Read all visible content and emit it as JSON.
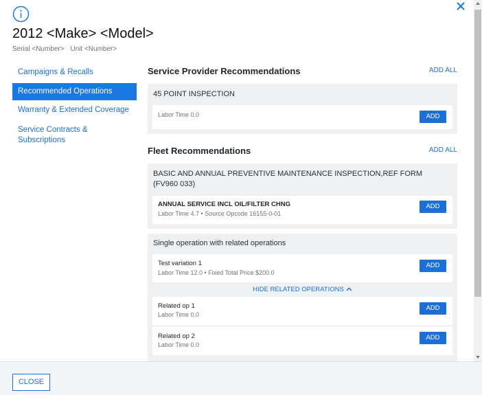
{
  "header": {
    "title": "2012 <Make> <Model>",
    "serial_label": "Serial",
    "serial_value": "<Number>",
    "unit_label": "Unit",
    "unit_value": "<Number>"
  },
  "sidebar": {
    "items": [
      {
        "label": "Campaigns & Recalls"
      },
      {
        "label": "Recommended Operations"
      },
      {
        "label": "Warranty & Extended Coverage"
      },
      {
        "label": "Service Contracts & Subscriptions"
      }
    ],
    "active_index": 1
  },
  "sections": {
    "service_provider": {
      "title": "Service Provider Recommendations",
      "add_all": "ADD ALL",
      "group_title": "45 POINT INSPECTION",
      "ops": [
        {
          "name": "",
          "meta": "Labor Time 0.0",
          "button": "ADD"
        }
      ]
    },
    "fleet": {
      "title": "Fleet Recommendations",
      "add_all": "ADD ALL",
      "group1": {
        "title": "BASIC AND ANNUAL PREVENTIVE MAINTENANCE INSPECTION,REF FORM (FV960 033)",
        "op": {
          "name": "ANNUAL SERVICE INCL OIL/FILTER CHNG",
          "meta": "Labor Time 4.7 • Source Opcode 16155-0-01",
          "button": "ADD"
        }
      },
      "group2": {
        "title": "Single operation with related operations",
        "op": {
          "name": "Test variation 1",
          "meta": "Labor Time 12.0 • Fixed Total Price $200.0",
          "button": "ADD"
        },
        "hide_related": "HIDE RELATED OPERATIONS",
        "related": [
          {
            "name": "Related op 1",
            "meta": "Labor Time 0.0",
            "button": "ADD"
          },
          {
            "name": "Related op 2",
            "meta": "Labor Time 0.0",
            "button": "ADD"
          }
        ]
      }
    }
  },
  "footer": {
    "close_label": "CLOSE"
  },
  "colors": {
    "accent": "#1b78e2",
    "link": "#1a6fd6",
    "group_bg": "#eef0f2"
  },
  "icons": {
    "info": "info-circle-icon",
    "close": "close-icon",
    "chevron": "chevron-up-icon"
  }
}
